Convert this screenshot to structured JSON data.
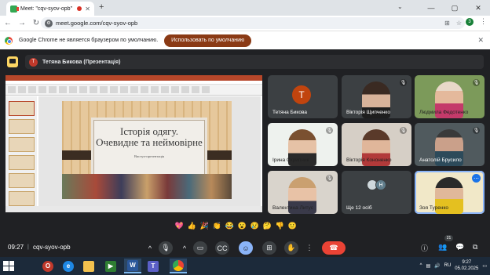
{
  "browser": {
    "tab_title": "Meet: \"cqv-syov-opb\"",
    "new_tab": "+",
    "url": "meet.google.com/cqv-syov-opb",
    "profile_letter": "3",
    "window_controls": [
      "—",
      "▢",
      "✕"
    ]
  },
  "infobar": {
    "text": "Google Chrome не является браузером по умолчанию.",
    "button": "Использовать по умолчанию",
    "close": "✕"
  },
  "meet": {
    "presenter_initial": "Т",
    "presenter_label": "Тетяна Бикова (Презентація)",
    "slide": {
      "title_line1": "Історія одягу.",
      "title_line2": "Очевидне та неймовірне",
      "subtitle": "Виступ-презентація"
    },
    "participants": [
      {
        "name": "Тетяна Бикова",
        "initial": "Т"
      },
      {
        "name": "Вікторія Щипченко"
      },
      {
        "name": "Людмила Федотенко"
      },
      {
        "name": "Ірина Скрипник"
      },
      {
        "name": "Вікторія Кононенко"
      },
      {
        "name": "Анатолій Брусило"
      },
      {
        "name": "Валентина Литус"
      },
      {
        "name": "Ще 12 осіб",
        "initial": "Н"
      },
      {
        "name": "Зоя Туренко"
      }
    ],
    "reactions": [
      "💖",
      "👍",
      "🎉",
      "👏",
      "😂",
      "😮",
      "😢",
      "🤔",
      "👎",
      "🙂"
    ]
  },
  "controls": {
    "time": "09:27",
    "separator": "|",
    "meeting_code": "cqv-syov-opb",
    "people_count": "21"
  },
  "taskbar": {
    "lang": "RU",
    "time": "9:27",
    "date": "05.02.2025"
  },
  "colors": {
    "accent": "#8a3a15",
    "meet_bg": "#202124",
    "tile_bg": "#3c4043",
    "end_call": "#ea4335",
    "active_ctrl": "#8ab4f8"
  }
}
